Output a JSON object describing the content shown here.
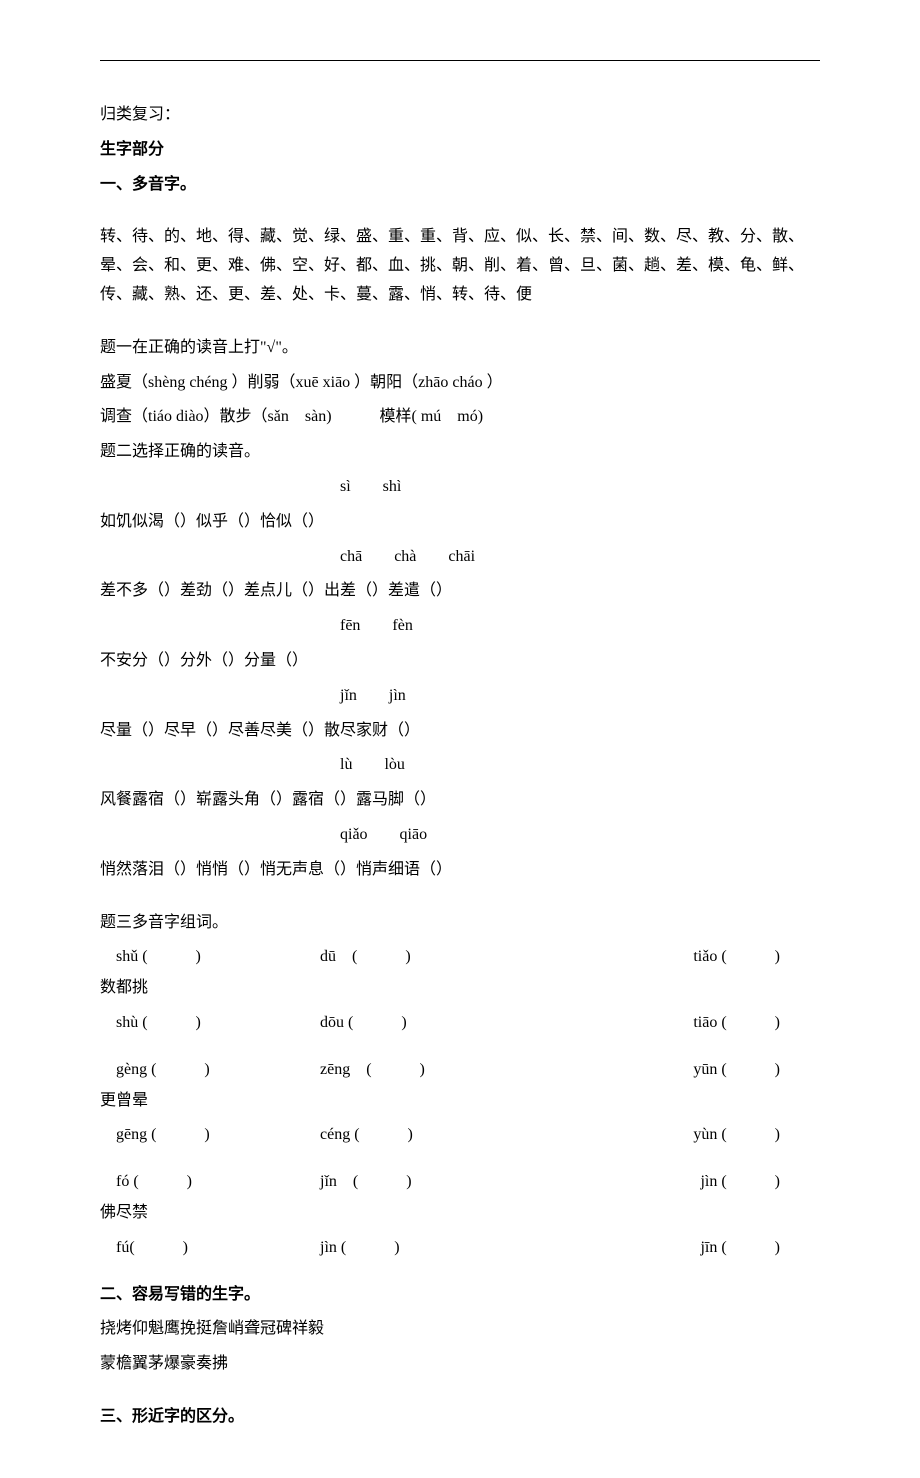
{
  "header_lead": "归类复习：",
  "h1": "生字部分",
  "h2_1": "一、多音字。",
  "duoyin_list": "转、待、的、地、得、藏、觉、绿、盛、重、重、背、应、似、长、禁、间、数、尽、教、分、散、晕、会、和、更、难、佛、空、好、都、血、挑、朝、削、着、曾、旦、菌、趟、差、模、龟、鲜、传、藏、熟、还、更、差、处、卡、蔓、露、悄、转、待、便",
  "q1_title": "题一在正确的读音上打\"√\"。",
  "q1_l1": "盛夏（shèng chéng ）削弱（xuē xiāo ）朝阳（zhāo cháo ）",
  "q1_l2": "调查（tiáo diào）散步（sǎn　sàn)　　　模样( mú　mó)",
  "q2_title": "题二选择正确的读音。",
  "q2_h1": "sì　　shì",
  "q2_l1": "如饥似渴（）似乎（）恰似（）",
  "q2_h2": "chā　　chà　　chāi",
  "q2_l2": "差不多（）差劲（）差点儿（）出差（）差遣（）",
  "q2_h3": "fēn　　fèn",
  "q2_l3": "不安分（）分外（）分量（）",
  "q2_h4": "jǐn　　jìn",
  "q2_l4": "尽量（）尽早（）尽善尽美（）散尽家财（）",
  "q2_h5": "lù　　lòu",
  "q2_l5": "风餐露宿（）崭露头角（）露宿（）露马脚（）",
  "q2_h6": "qiǎo　　qiāo",
  "q2_l6": "悄然落泪（）悄悄（）悄无声息（）悄声细语（）",
  "q3_title": "题三多音字组词。",
  "grid": [
    {
      "a": "　shǔ (　　　)",
      "b": "dū　(　　　)",
      "c": "tiǎo (　　　)",
      "label": "数都挑"
    },
    {
      "a": "　shù (　　　)",
      "b": "dōu (　　　)",
      "c": "tiāo (　　　)",
      "label": ""
    },
    {
      "a": "　gèng (　　　)",
      "b": "zēng　(　　　)",
      "c": "yūn (　　　)",
      "label": "更曾晕"
    },
    {
      "a": "　gēng (　　　)",
      "b": "céng (　　　)",
      "c": "yùn (　　　)",
      "label": ""
    },
    {
      "a": "　fó (　　　)",
      "b": "jǐn　(　　　)",
      "c": "jìn (　　　)",
      "label": "佛尽禁"
    },
    {
      "a": "　fú(　　　)",
      "b": "jìn (　　　)",
      "c": "jīn (　　　)",
      "label": ""
    }
  ],
  "h2_2": "二、容易写错的生字。",
  "err_l1": "挠烤仰魁鹰挽挺詹峭聋冠碑祥毅",
  "err_l2": "蒙檐翼茅爆豪奏拂",
  "h2_3": "三、形近字的区分。"
}
